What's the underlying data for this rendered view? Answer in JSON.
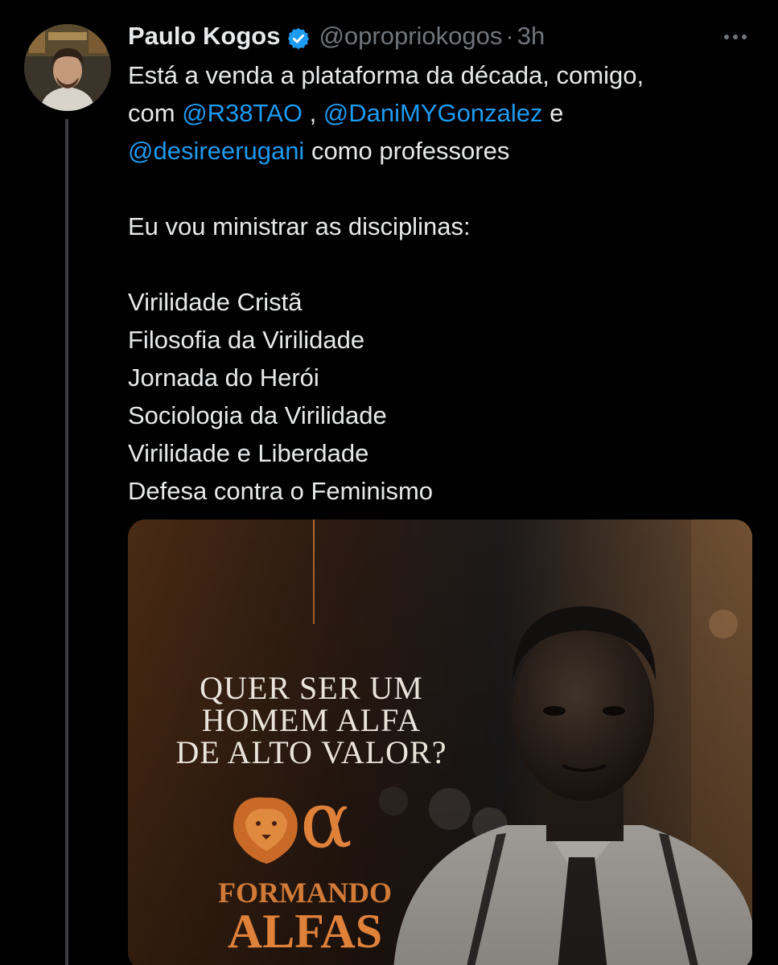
{
  "tweet": {
    "display_name": "Paulo Kogos",
    "handle": "@opropriokogos",
    "separator": "·",
    "time": "3h",
    "text_lines": [
      {
        "parts": [
          {
            "t": "Está a venda a plataforma da década, comigo,",
            "m": false
          }
        ]
      },
      {
        "parts": [
          {
            "t": "com ",
            "m": false
          },
          {
            "t": "@R38TAO",
            "m": true
          },
          {
            "t": " , ",
            "m": false
          },
          {
            "t": "@DaniMYGonzalez",
            "m": true
          },
          {
            "t": " e",
            "m": false
          }
        ]
      },
      {
        "parts": [
          {
            "t": "@desireerugani",
            "m": true
          },
          {
            "t": " como professores",
            "m": false
          }
        ]
      },
      {
        "gap": true
      },
      {
        "parts": [
          {
            "t": "Eu vou ministrar as disciplinas:",
            "m": false
          }
        ]
      },
      {
        "gap": true
      },
      {
        "parts": [
          {
            "t": "Virilidade Cristã",
            "m": false
          }
        ]
      },
      {
        "parts": [
          {
            "t": "Filosofia da Virilidade",
            "m": false
          }
        ]
      },
      {
        "parts": [
          {
            "t": "Jornada do Herói",
            "m": false
          }
        ]
      },
      {
        "parts": [
          {
            "t": "Sociologia da Virilidade",
            "m": false
          }
        ]
      },
      {
        "parts": [
          {
            "t": "Virilidade e Liberdade",
            "m": false
          }
        ]
      },
      {
        "parts": [
          {
            "t": "Defesa contra o Feminismo",
            "m": false
          }
        ]
      }
    ]
  },
  "media": {
    "headline_lines": [
      "Quer ser um",
      "Homem Alfa",
      "de alto valor?"
    ],
    "brand_top": "FORMANDO",
    "brand_bottom": "ALFAS",
    "brand_symbol": "α"
  },
  "icons": {
    "verified": "verified-badge-icon",
    "more": "more-options-icon",
    "lion": "lion-head-icon"
  },
  "colors": {
    "background": "#000000",
    "text": "#e7e9ea",
    "secondary": "#71767b",
    "mention": "#1d9bf0",
    "verified": "#1d9bf0",
    "brand_orange": "#e0813a"
  }
}
